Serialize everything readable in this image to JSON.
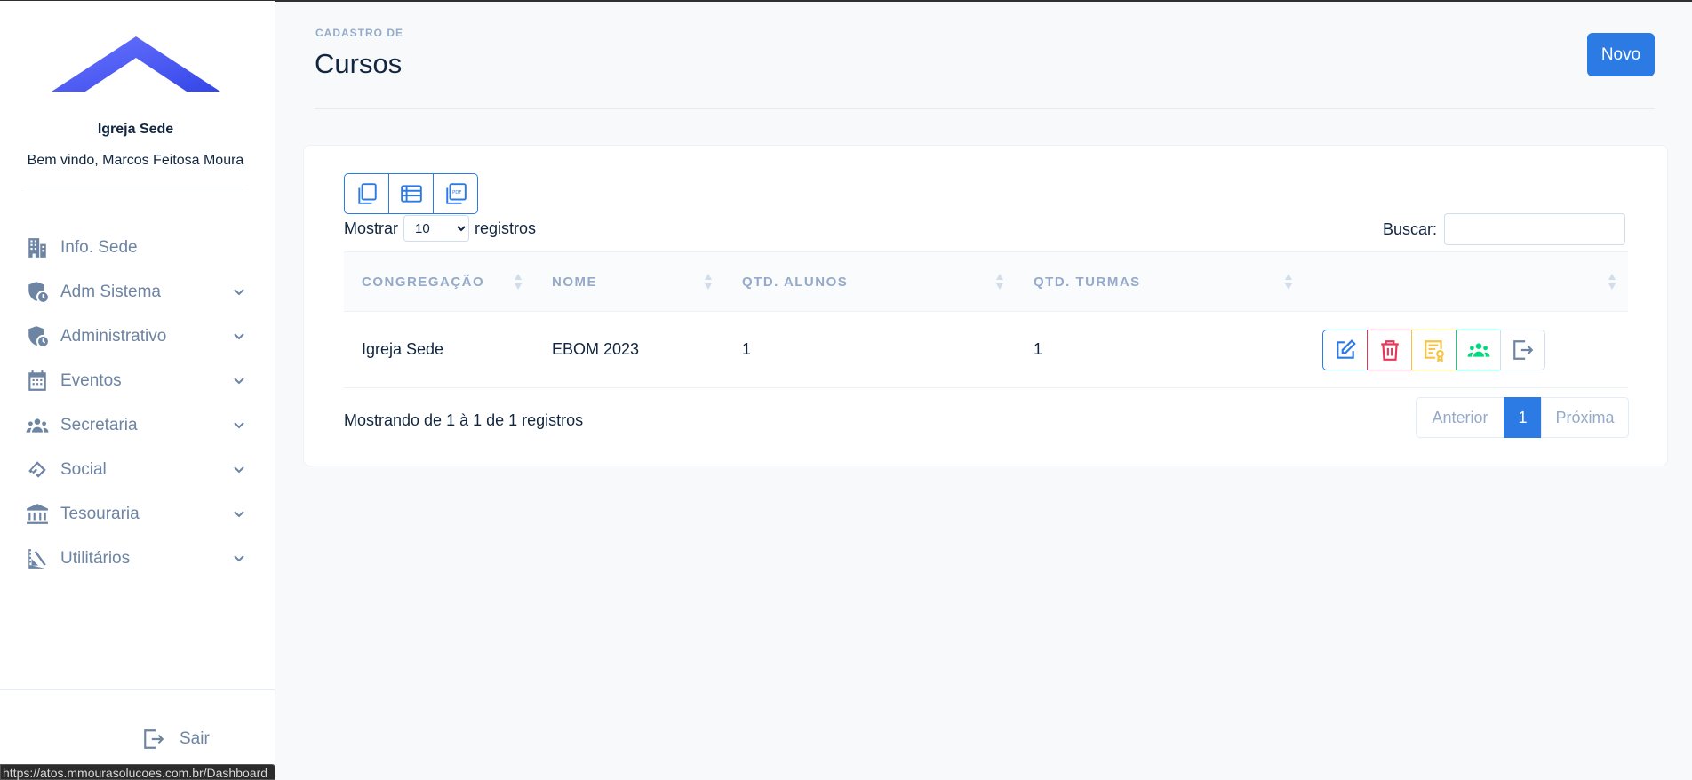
{
  "sidebar": {
    "church_name": "Igreja Sede",
    "welcome": "Bem vindo, Marcos Feitosa Moura",
    "items": [
      {
        "label": "Info. Sede",
        "icon": "building-icon",
        "has_submenu": false
      },
      {
        "label": "Adm Sistema",
        "icon": "shield-clock-icon",
        "has_submenu": true
      },
      {
        "label": "Administrativo",
        "icon": "shield-clock-icon",
        "has_submenu": true
      },
      {
        "label": "Eventos",
        "icon": "calendar-icon",
        "has_submenu": true
      },
      {
        "label": "Secretaria",
        "icon": "users-icon",
        "has_submenu": true
      },
      {
        "label": "Social",
        "icon": "handshake-icon",
        "has_submenu": true
      },
      {
        "label": "Tesouraria",
        "icon": "bank-icon",
        "has_submenu": true
      },
      {
        "label": "Utilitários",
        "icon": "set-square-icon",
        "has_submenu": true
      }
    ],
    "logout_label": "Sair"
  },
  "status_bar": {
    "url": "https://atos.mmourasolucoes.com.br/Dashboard"
  },
  "header": {
    "pretitle": "CADASTRO DE",
    "title": "Cursos",
    "new_button": "Novo"
  },
  "toolbar": {
    "export_icons": [
      "copy-icon",
      "csv-icon",
      "pdf-icon"
    ],
    "length_prefix": "Mostrar",
    "length_value": "10",
    "length_suffix": "registros",
    "search_label": "Buscar:",
    "search_value": ""
  },
  "table": {
    "columns": [
      "CONGREGAÇÃO",
      "NOME",
      "QTD. ALUNOS",
      "QTD. TURMAS",
      ""
    ],
    "rows": [
      {
        "congregacao": "Igreja Sede",
        "nome": "EBOM 2023",
        "qtd_alunos": "1",
        "qtd_turmas": "1"
      }
    ],
    "row_actions": [
      "edit-icon",
      "trash-icon",
      "certificate-icon",
      "users-icon",
      "exit-icon"
    ]
  },
  "footer": {
    "info": "Mostrando de 1 à 1 de 1 registros",
    "prev": "Anterior",
    "page": "1",
    "next": "Próxima"
  },
  "colors": {
    "primary": "#2c7be5",
    "danger": "#e63757",
    "warning": "#f6c343",
    "success": "#00d97e",
    "logo": "#4b5cf0"
  }
}
